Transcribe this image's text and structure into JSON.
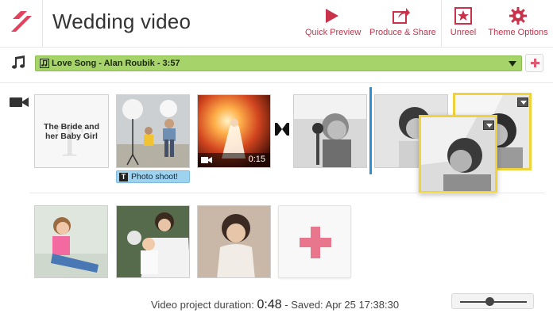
{
  "app": {
    "title": "Wedding video"
  },
  "toolbar": {
    "items": [
      {
        "label": "Quick Preview",
        "icon": "play-icon"
      },
      {
        "label": "Produce & Share",
        "icon": "share-icon"
      },
      {
        "label": "Unreel",
        "icon": "star-box-icon"
      },
      {
        "label": "Theme Options",
        "icon": "gear-icon"
      }
    ],
    "accent_color": "#c8324a"
  },
  "audio": {
    "track_label": "Love Song - Alan Roubik - 3:57",
    "track_color": "#a6d46a"
  },
  "timeline": {
    "title_card_text": "The Bride and her Baby Girl",
    "caption_chip": "Photo shoot!",
    "video_clip_duration": "0:15"
  },
  "footer": {
    "duration_label": "Video project duration:",
    "duration_value": "0:48",
    "saved_text": "- Saved: Apr 25 17:38:30"
  },
  "zoom": {
    "level": 0.45
  }
}
